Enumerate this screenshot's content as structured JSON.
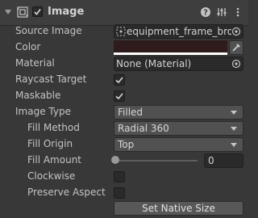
{
  "header": {
    "title": "Image",
    "enabled": true,
    "icons": [
      "rect-transform-icon",
      "help-icon",
      "preset-icon",
      "more-icon"
    ]
  },
  "fields": {
    "source_image": {
      "label": "Source Image",
      "value": "equipment_frame_brow"
    },
    "color": {
      "label": "Color",
      "swatch_color": "#2f1b1b",
      "alpha_color": "#ffffff"
    },
    "material": {
      "label": "Material",
      "value": "None (Material)"
    },
    "raycast_target": {
      "label": "Raycast Target",
      "checked": true
    },
    "maskable": {
      "label": "Maskable",
      "checked": true
    },
    "image_type": {
      "label": "Image Type",
      "value": "Filled"
    },
    "fill_method": {
      "label": "Fill Method",
      "value": "Radial 360"
    },
    "fill_origin": {
      "label": "Fill Origin",
      "value": "Top"
    },
    "fill_amount": {
      "label": "Fill Amount",
      "value": "0",
      "fraction": 0
    },
    "clockwise": {
      "label": "Clockwise",
      "checked": false
    },
    "preserve_aspect": {
      "label": "Preserve Aspect",
      "checked": false
    }
  },
  "buttons": {
    "set_native_size": "Set Native Size"
  }
}
